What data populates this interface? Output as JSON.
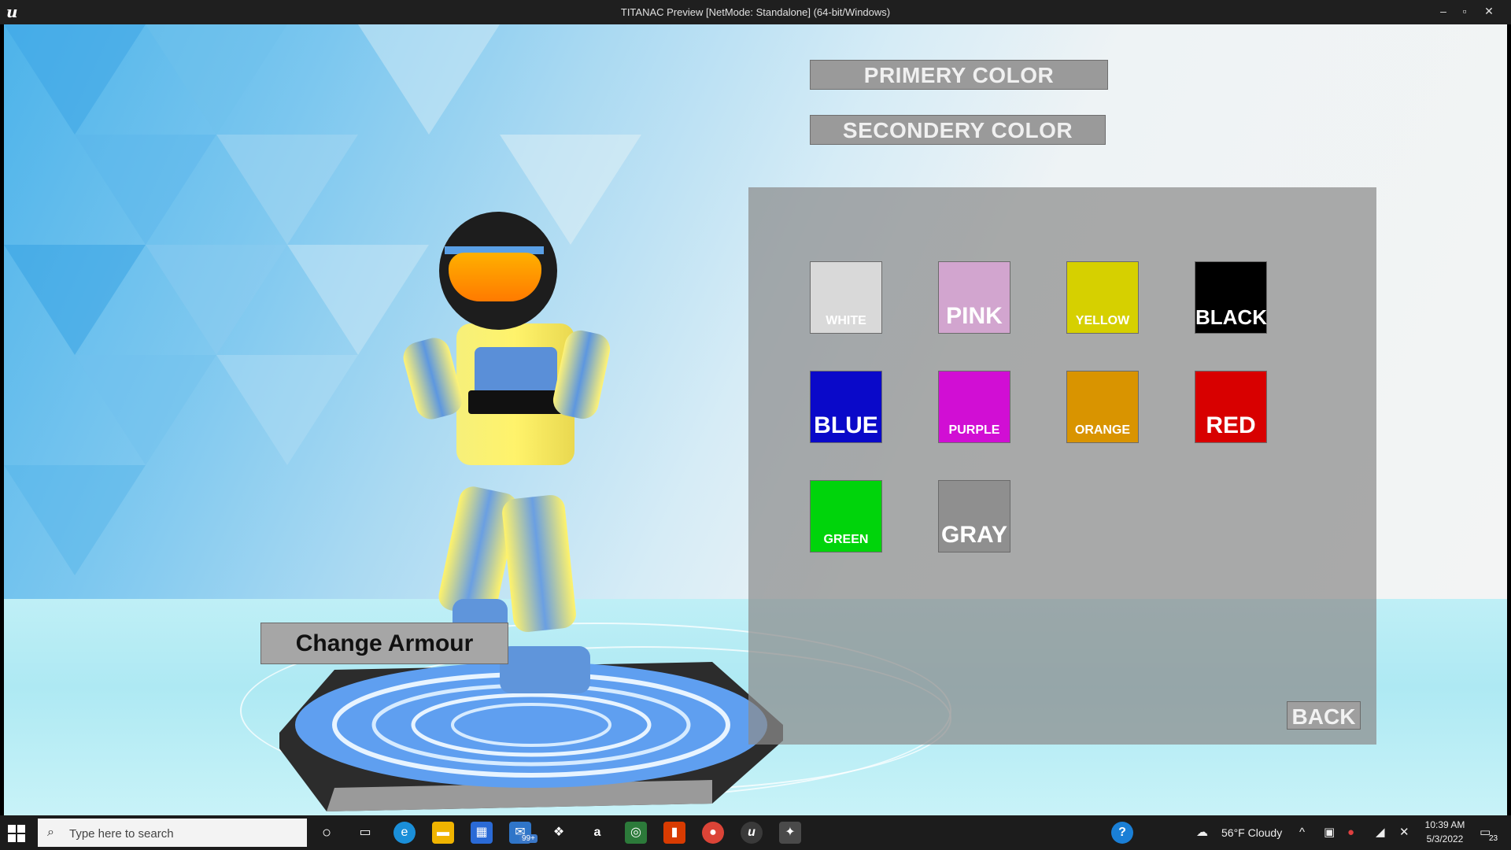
{
  "window": {
    "title": "TITANAC Preview [NetMode: Standalone]  (64-bit/Windows)",
    "logo": "u",
    "minimize": "–",
    "maximize": "▫",
    "close": "✕"
  },
  "color_mode": {
    "primary_label": "PRIMERY COLOR",
    "secondary_label": "SECONDERY COLOR"
  },
  "swatches": [
    {
      "label": "WHITE",
      "color": "#d9d9d9"
    },
    {
      "label": "PINK",
      "color": "#d2a5cf"
    },
    {
      "label": "YELLOW",
      "color": "#d6d000"
    },
    {
      "label": "BLACK",
      "color": "#000000"
    },
    {
      "label": "BLUE",
      "color": "#0a09c9"
    },
    {
      "label": "PURPLE",
      "color": "#d10ed4"
    },
    {
      "label": "ORANGE",
      "color": "#d99400"
    },
    {
      "label": "RED",
      "color": "#d80000"
    },
    {
      "label": "GREEN",
      "color": "#00d40b"
    },
    {
      "label": "GRAY",
      "color": "#8f8f8f"
    }
  ],
  "back_label": "BACK",
  "armour_label": "Change Armour",
  "taskbar": {
    "search_placeholder": "Type here to search",
    "mail_badge": "99+",
    "weather": "56°F  Cloudy",
    "time": "10:39 AM",
    "date": "5/3/2022",
    "notifications": "23",
    "help": "?"
  }
}
